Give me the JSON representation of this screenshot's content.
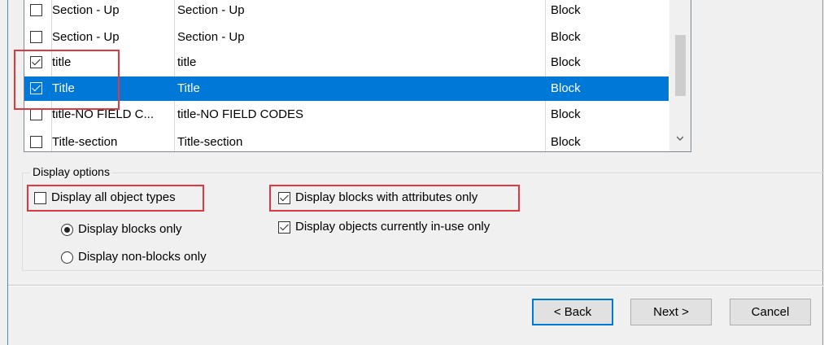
{
  "list": {
    "rows": [
      {
        "name": "Section - Up",
        "description": "Section - Up",
        "type": "Block",
        "checked": false,
        "selected": false
      },
      {
        "name": "Section - Up",
        "description": "Section - Up",
        "type": "Block",
        "checked": false,
        "selected": false
      },
      {
        "name": "title",
        "description": "title",
        "type": "Block",
        "checked": true,
        "selected": false
      },
      {
        "name": "Title",
        "description": "Title",
        "type": "Block",
        "checked": true,
        "selected": true
      },
      {
        "name": "title-NO FIELD C...",
        "description": "title-NO FIELD CODES",
        "type": "Block",
        "checked": false,
        "selected": false
      },
      {
        "name": "Title-section",
        "description": "Title-section",
        "type": "Block",
        "checked": false,
        "selected": false
      }
    ]
  },
  "display_options": {
    "legend": "Display options",
    "display_all_object_types": {
      "label": "Display all object types",
      "checked": false
    },
    "display_blocks_only": {
      "label": "Display blocks only",
      "selected": true
    },
    "display_non_blocks_only": {
      "label": "Display non-blocks only",
      "selected": false
    },
    "display_blocks_with_attributes_only": {
      "label": "Display blocks with attributes only",
      "checked": true
    },
    "display_objects_in_use_only": {
      "label": "Display objects currently in-use only",
      "checked": true
    }
  },
  "buttons": {
    "back": "< Back",
    "next": "Next >",
    "cancel": "Cancel"
  },
  "colors": {
    "selection": "#0078d7",
    "highlight_box": "#e0383e"
  }
}
